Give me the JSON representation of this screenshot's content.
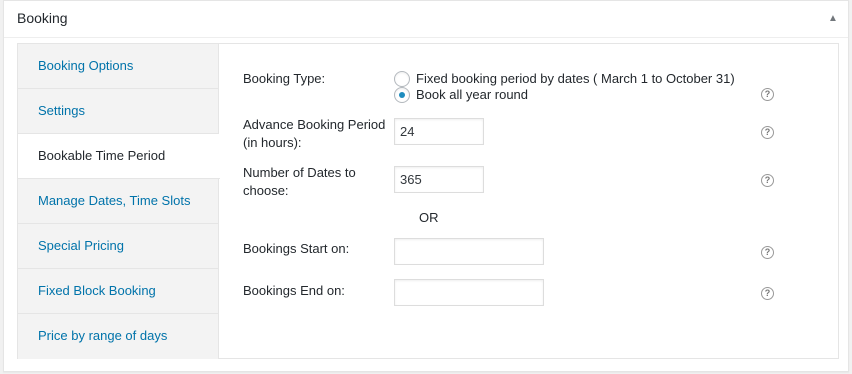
{
  "box": {
    "title": "Booking",
    "toggle": "▲"
  },
  "tabs": [
    {
      "label": "Booking Options",
      "active": false
    },
    {
      "label": "Settings",
      "active": false
    },
    {
      "label": "Bookable Time Period",
      "active": true
    },
    {
      "label": "Manage Dates, Time Slots",
      "active": false
    },
    {
      "label": "Special Pricing",
      "active": false
    },
    {
      "label": "Fixed Block Booking",
      "active": false
    },
    {
      "label": "Price by range of days",
      "active": false
    }
  ],
  "form": {
    "booking_type": {
      "label": "Booking Type:",
      "options": [
        {
          "label": "Fixed booking period by dates ( March 1 to October 31)",
          "checked": false
        },
        {
          "label": "Book all year round",
          "checked": true
        }
      ]
    },
    "advance_period": {
      "label_line1": "Advance Booking Period",
      "label_line2": "(in hours):",
      "value": "24"
    },
    "num_dates": {
      "label_line1": "Number of Dates to",
      "label_line2": "choose:",
      "value": "365"
    },
    "or_text": "OR",
    "start_on": {
      "label": "Bookings Start on:",
      "value": ""
    },
    "end_on": {
      "label": "Bookings End on:",
      "value": ""
    },
    "help_glyph": "?"
  },
  "colors": {
    "link": "#0073aa",
    "radio_checked": "#1e8cbe"
  }
}
